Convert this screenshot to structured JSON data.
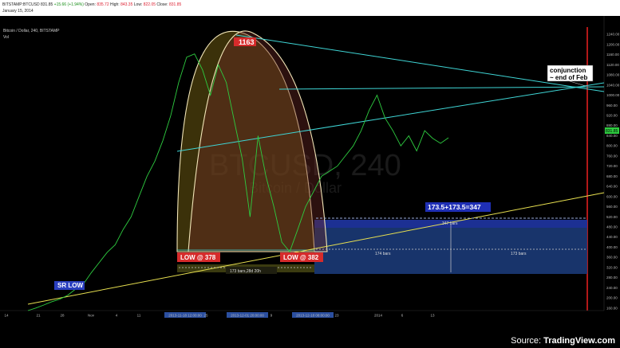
{
  "header": {
    "symbol": "BITSTAMP:BTCUSD",
    "last": "831.85",
    "change": "+15.66 (+1.94%)",
    "open_label": "Open:",
    "open": "835.72",
    "high_label": "High:",
    "high": "843.35",
    "low_label": "Low:",
    "low": "822.05",
    "close_label": "Close:",
    "close": "831.85",
    "date": "January 15, 2014"
  },
  "pane": {
    "title": "Bitcoin / Dollar, 240, BITSTAMP",
    "vol": "Vol",
    "watermark_big": "BTCUSD, 240",
    "watermark_small": "Bitcoin / Dollar"
  },
  "annotations": {
    "peak": "1163",
    "low1": "LOW @ 378",
    "low2": "LOW @ 382",
    "sr_low": "SR LOW",
    "conjunction_l1": "conjunction",
    "conjunction_l2": "~ end of Feb",
    "measure": "173.5+173.5=347",
    "bars_347": "347 bars",
    "bars_174": "174 bars",
    "bars_173": "173 bars",
    "bars_173_28d": "173 bars,28d 20h",
    "current_price": "831.85"
  },
  "footer": {
    "source_prefix": "Source:",
    "source_name": "TradingView.com"
  },
  "colors": {
    "price": "#2ecc40",
    "trend": "#3fd6d6",
    "support": "#e8e050",
    "arc": "#f2e6b8",
    "arc_fill": "#6b5a12",
    "arc2_fill": "#6e2a26",
    "zone": "#1b3a77",
    "red_line": "#e01f1f",
    "label_red": "#d62b2b",
    "label_blue": "#1f2fb5",
    "label_sr": "#2a3fbf"
  },
  "chart_data": {
    "type": "line",
    "title": "Bitcoin / Dollar, 240, BITSTAMP",
    "ylim": [
      150,
      1250
    ],
    "y_ticks": [
      "1240.00",
      "1200.00",
      "1160.00",
      "1120.00",
      "1080.00",
      "1040.00",
      "1000.00",
      "960.00",
      "920.00",
      "880.00",
      "840.00",
      "800.00",
      "760.00",
      "720.00",
      "680.00",
      "640.00",
      "600.00",
      "560.00",
      "520.00",
      "480.00",
      "440.00",
      "400.00",
      "360.00",
      "320.00",
      "280.00",
      "240.00",
      "200.00",
      "160.00"
    ],
    "x_ticks": [
      "14",
      "21",
      "28",
      "Nov",
      "4",
      "11",
      "2013-11-18 12:00:00",
      "25",
      "2013-12-01 20:00:00",
      "9",
      "2013-12-18 08:00:00",
      "23",
      "2014",
      "6",
      "13"
    ],
    "series": [
      {
        "values": [
          150,
          160,
          172,
          185,
          195,
          210,
          235,
          255,
          300,
          340,
          380,
          410,
          470,
          520,
          600,
          680,
          740,
          820,
          920,
          1050,
          1150,
          1163,
          1100,
          1000,
          1120,
          1050,
          900,
          750,
          520,
          840,
          680,
          560,
          420,
          382,
          470,
          560,
          620,
          680,
          700,
          720,
          760,
          800,
          860,
          940,
          1000,
          910,
          860,
          800,
          840,
          780,
          860,
          830,
          810,
          831.85
        ],
        "color": "#2ecc40"
      }
    ],
    "grid": false,
    "legend": "none"
  }
}
